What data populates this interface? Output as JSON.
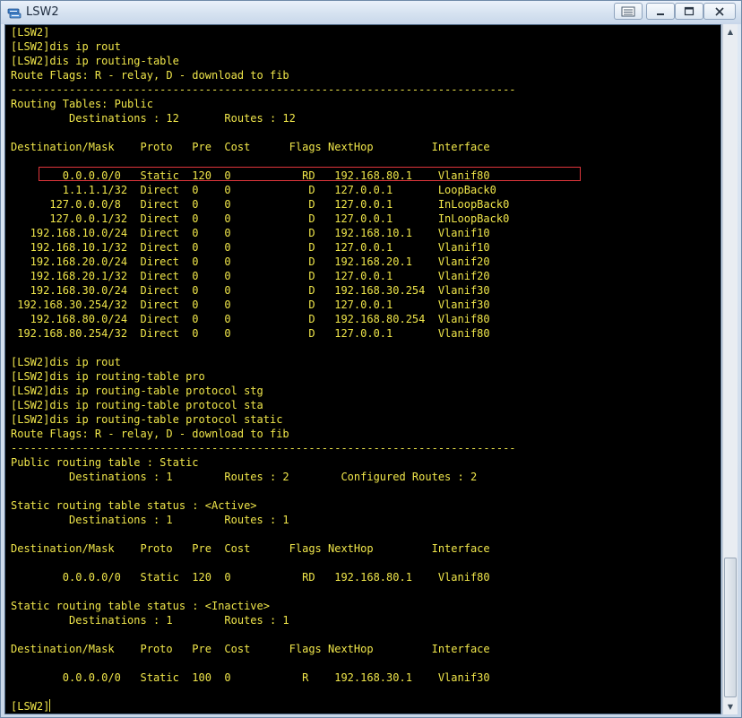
{
  "window": {
    "title": "LSW2",
    "icon": "switch-icon",
    "controls": [
      "restore-icon",
      "minimize-icon",
      "maximize-icon",
      "close-icon"
    ]
  },
  "terminal": {
    "lines": [
      "[LSW2]",
      "[LSW2]dis ip rout",
      "[LSW2]dis ip routing-table",
      "Route Flags: R - relay, D - download to fib",
      "------------------------------------------------------------------------------",
      "Routing Tables: Public",
      "         Destinations : 12       Routes : 12",
      "",
      "Destination/Mask    Proto   Pre  Cost      Flags NextHop         Interface",
      "",
      "        0.0.0.0/0   Static  120  0           RD   192.168.80.1    Vlanif80",
      "        1.1.1.1/32  Direct  0    0            D   127.0.0.1       LoopBack0",
      "      127.0.0.0/8   Direct  0    0            D   127.0.0.1       InLoopBack0",
      "      127.0.0.1/32  Direct  0    0            D   127.0.0.1       InLoopBack0",
      "   192.168.10.0/24  Direct  0    0            D   192.168.10.1    Vlanif10",
      "   192.168.10.1/32  Direct  0    0            D   127.0.0.1       Vlanif10",
      "   192.168.20.0/24  Direct  0    0            D   192.168.20.1    Vlanif20",
      "   192.168.20.1/32  Direct  0    0            D   127.0.0.1       Vlanif20",
      "   192.168.30.0/24  Direct  0    0            D   192.168.30.254  Vlanif30",
      " 192.168.30.254/32  Direct  0    0            D   127.0.0.1       Vlanif30",
      "   192.168.80.0/24  Direct  0    0            D   192.168.80.254  Vlanif80",
      " 192.168.80.254/32  Direct  0    0            D   127.0.0.1       Vlanif80",
      "",
      "[LSW2]dis ip rout",
      "[LSW2]dis ip routing-table pro",
      "[LSW2]dis ip routing-table protocol stg",
      "[LSW2]dis ip routing-table protocol sta",
      "[LSW2]dis ip routing-table protocol static",
      "Route Flags: R - relay, D - download to fib",
      "------------------------------------------------------------------------------",
      "Public routing table : Static",
      "         Destinations : 1        Routes : 2        Configured Routes : 2",
      "",
      "Static routing table status : <Active>",
      "         Destinations : 1        Routes : 1",
      "",
      "Destination/Mask    Proto   Pre  Cost      Flags NextHop         Interface",
      "",
      "        0.0.0.0/0   Static  120  0           RD   192.168.80.1    Vlanif80",
      "",
      "Static routing table status : <Inactive>",
      "         Destinations : 1        Routes : 1",
      "",
      "Destination/Mask    Proto   Pre  Cost      Flags NextHop         Interface",
      "",
      "        0.0.0.0/0   Static  100  0           R    192.168.30.1    Vlanif30",
      ""
    ],
    "prompt": "[LSW2]"
  },
  "colors": {
    "terminal_bg": "#000000",
    "terminal_fg": "#f0e64a",
    "highlight_box": "#e0363c"
  }
}
